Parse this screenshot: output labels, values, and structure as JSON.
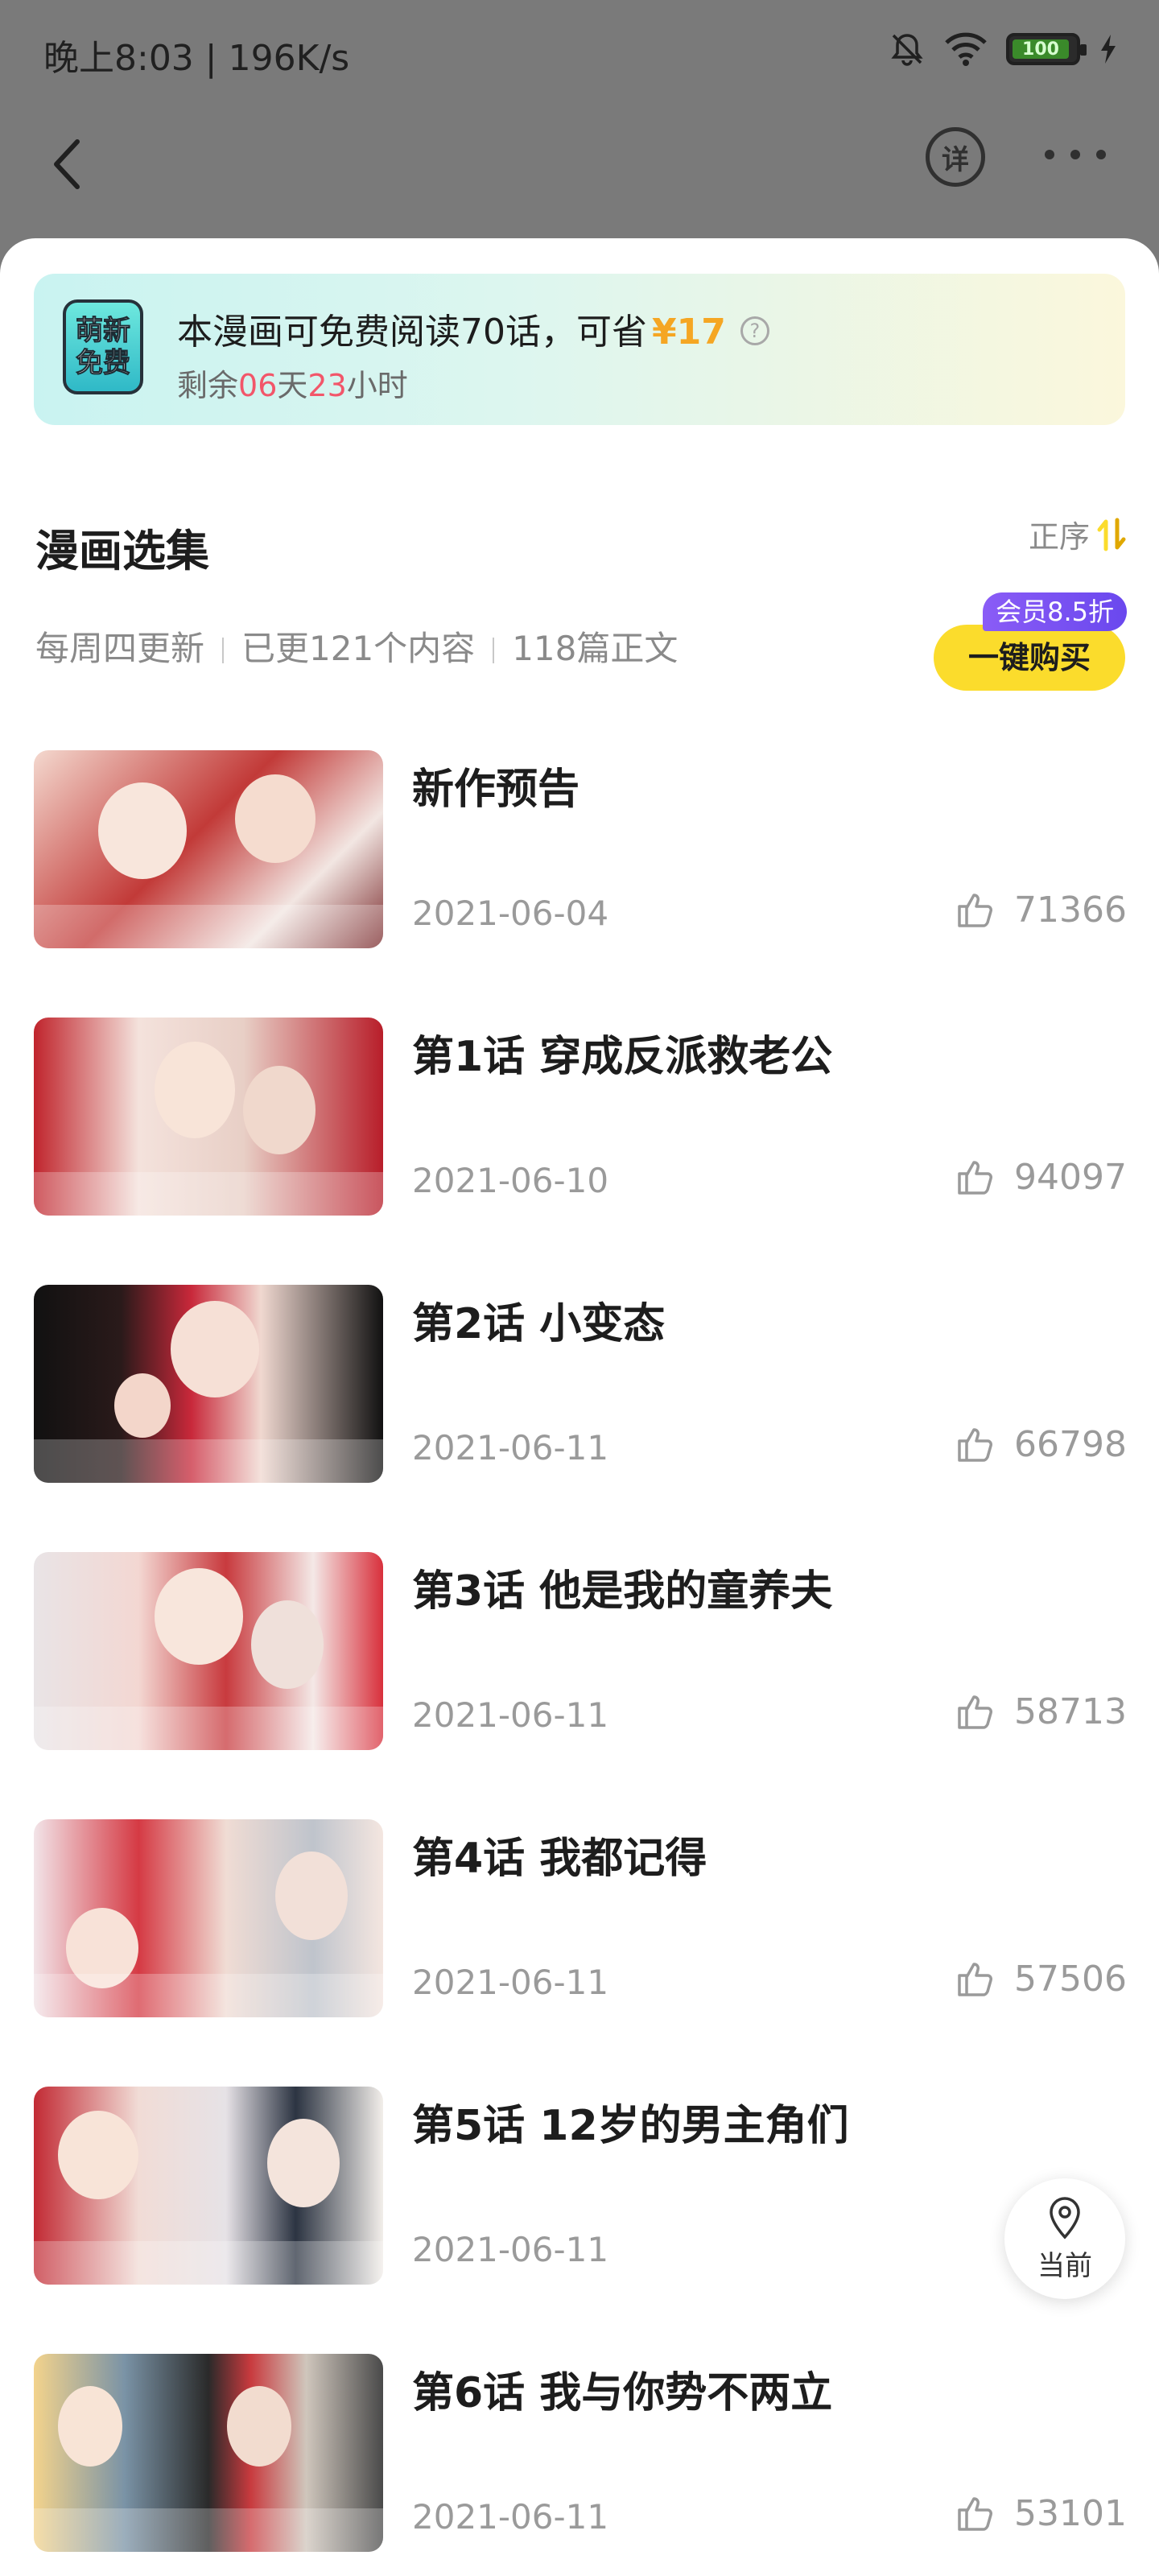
{
  "status_bar": {
    "time": "晚上8:03 | 196K/s",
    "battery": "100"
  },
  "header": {
    "detail_label": "详"
  },
  "promo": {
    "badge_line1": "萌新",
    "badge_line2": "免费",
    "title": "本漫画可免费阅读70话，可省",
    "price": "¥17",
    "sub_prefix": "剩余",
    "days": "06",
    "days_unit": "天",
    "hours": "23",
    "hours_unit": "小时"
  },
  "section": {
    "title": "漫画选集",
    "sort_label": "正序",
    "meta": [
      "每周四更新",
      "已更121个内容",
      "118篇正文"
    ],
    "vip_tag": "会员8.5折",
    "buy_label": "一键购买"
  },
  "episodes": [
    {
      "title": "新作预告",
      "date": "2021-06-04",
      "likes": "71366"
    },
    {
      "title": "第1话 穿成反派救老公",
      "date": "2021-06-10",
      "likes": "94097"
    },
    {
      "title": "第2话 小变态",
      "date": "2021-06-11",
      "likes": "66798"
    },
    {
      "title": "第3话 他是我的童养夫",
      "date": "2021-06-11",
      "likes": "58713"
    },
    {
      "title": "第4话 我都记得",
      "date": "2021-06-11",
      "likes": "57506"
    },
    {
      "title": "第5话 12岁的男主角们",
      "date": "2021-06-11",
      "likes": ""
    },
    {
      "title": "第6话 我与你势不两立",
      "date": "2021-06-11",
      "likes": "53101"
    }
  ],
  "float_button": {
    "label": "当前"
  },
  "colors": {
    "accent_yellow": "#fbdc2c",
    "price_orange": "#f5a623",
    "countdown_red": "#f2566a",
    "vip_purple": "#7a52f2"
  }
}
